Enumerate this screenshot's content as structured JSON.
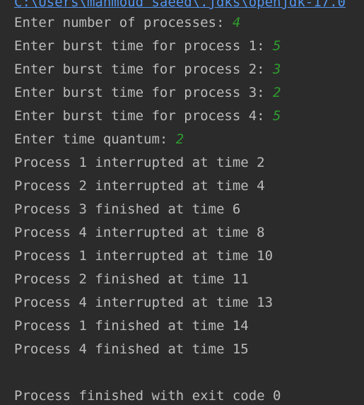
{
  "console": {
    "command_path": "C:\\Users\\mahmoud saeed\\.jdks\\openjdk-17.0",
    "lines": [
      {
        "text": "Enter number of processes: ",
        "input": "4"
      },
      {
        "text": "Enter burst time for process 1: ",
        "input": "5"
      },
      {
        "text": "Enter burst time for process 2: ",
        "input": "3"
      },
      {
        "text": "Enter burst time for process 3: ",
        "input": "2"
      },
      {
        "text": "Enter burst time for process 4: ",
        "input": "5"
      },
      {
        "text": "Enter time quantum: ",
        "input": "2"
      },
      {
        "text": "Process 1 interrupted at time 2",
        "input": ""
      },
      {
        "text": "Process 2 interrupted at time 4",
        "input": ""
      },
      {
        "text": "Process 3 finished at time 6",
        "input": ""
      },
      {
        "text": "Process 4 interrupted at time 8",
        "input": ""
      },
      {
        "text": "Process 1 interrupted at time 10",
        "input": ""
      },
      {
        "text": "Process 2 finished at time 11",
        "input": ""
      },
      {
        "text": "Process 4 interrupted at time 13",
        "input": ""
      },
      {
        "text": "Process 1 finished at time 14",
        "input": ""
      },
      {
        "text": "Process 4 finished at time 15",
        "input": ""
      },
      {
        "text": "",
        "input": ""
      },
      {
        "text": "Process finished with exit code 0",
        "input": ""
      }
    ]
  },
  "colors": {
    "background": "#2b2b2b",
    "text": "#bbbbbb",
    "input": "#2e9e2e",
    "link": "#5394ec"
  }
}
